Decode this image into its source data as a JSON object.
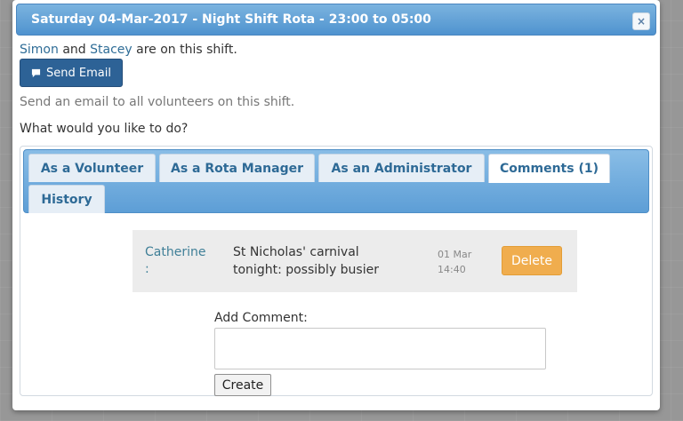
{
  "dialog": {
    "title": "Saturday 04-Mar-2017 - Night Shift Rota - 23:00 to 05:00",
    "close_glyph": "×"
  },
  "shift": {
    "volunteer1": "Simon",
    "joiner": "and",
    "volunteer2": "Stacey",
    "suffix": "are on this shift."
  },
  "send_email": {
    "icon": "comment-icon",
    "label": "Send Email",
    "description": "Send an email to all volunteers on this shift."
  },
  "prompt": "What would you like to do?",
  "tabs": [
    {
      "label": "As a Volunteer",
      "active": false
    },
    {
      "label": "As a Rota Manager",
      "active": false
    },
    {
      "label": "As an Administrator",
      "active": false
    },
    {
      "label": "Comments (1)",
      "active": true
    },
    {
      "label": "History",
      "active": false
    }
  ],
  "comments": [
    {
      "author": "Catherine",
      "colon": ":",
      "text": "St Nicholas' carnival tonight: possibly busier",
      "date": "01 Mar",
      "time": "14:40",
      "delete_label": "Delete"
    }
  ],
  "add_comment": {
    "label": "Add Comment:",
    "value": "",
    "create_label": "Create"
  },
  "colors": {
    "title_bar": "#5d9ed6",
    "send_button": "#2d6296",
    "delete_button": "#f0ad4e",
    "link": "#2f6d97"
  }
}
